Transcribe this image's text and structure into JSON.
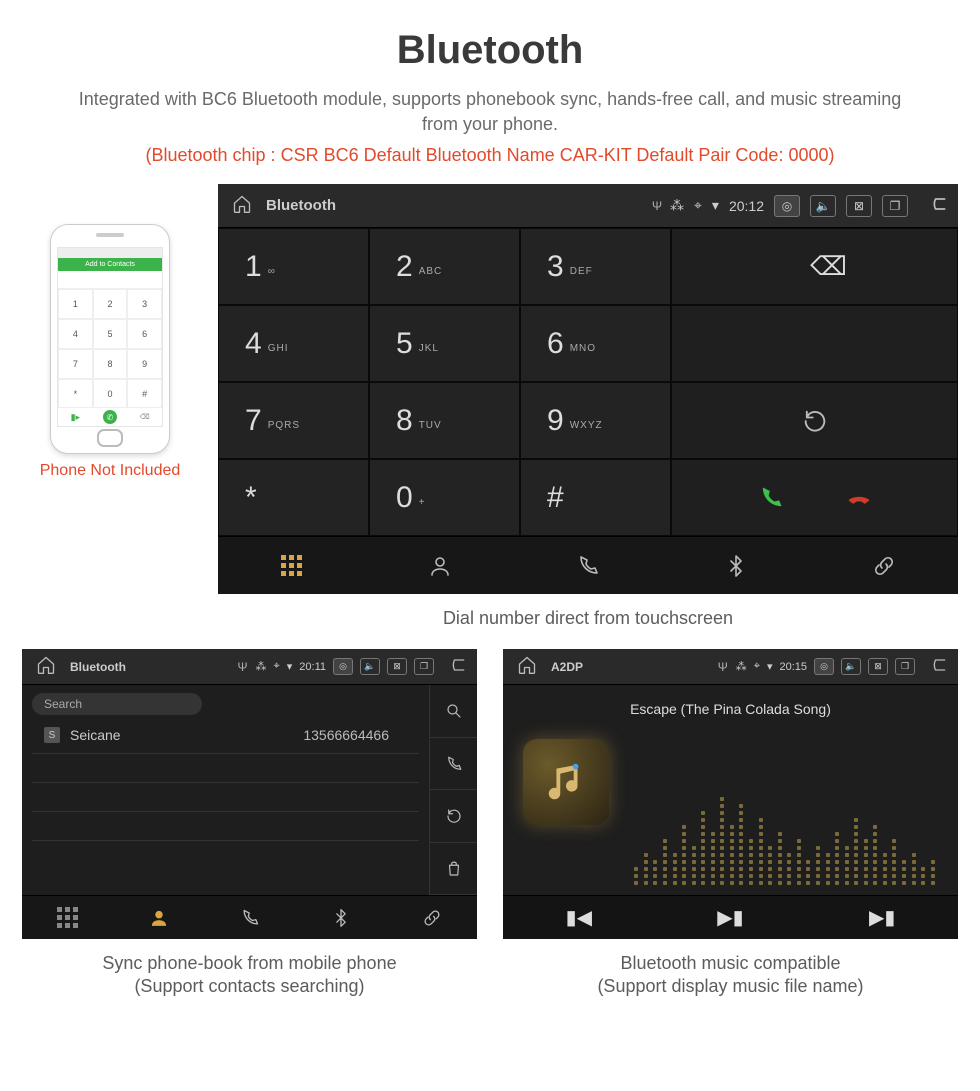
{
  "header": {
    "title": "Bluetooth",
    "subtitle": "Integrated with BC6 Bluetooth module, supports phonebook sync, hands-free call, and music streaming from your phone.",
    "spec": "(Bluetooth chip : CSR BC6     Default Bluetooth Name CAR-KIT     Default Pair Code: 0000)"
  },
  "phone": {
    "bar_label": "Add to Contacts",
    "caption": "Phone Not Included",
    "keys": [
      "1",
      "2",
      "3",
      "4",
      "5",
      "6",
      "7",
      "8",
      "9",
      "*",
      "0",
      "#"
    ]
  },
  "dialer": {
    "status": {
      "app": "Bluetooth",
      "time": "20:12"
    },
    "keys": [
      {
        "n": "1",
        "s": "∞"
      },
      {
        "n": "2",
        "s": "ABC"
      },
      {
        "n": "3",
        "s": "DEF"
      },
      {
        "n": "4",
        "s": "GHI"
      },
      {
        "n": "5",
        "s": "JKL"
      },
      {
        "n": "6",
        "s": "MNO"
      },
      {
        "n": "7",
        "s": "PQRS"
      },
      {
        "n": "8",
        "s": "TUV"
      },
      {
        "n": "9",
        "s": "WXYZ"
      },
      {
        "n": "*",
        "s": ""
      },
      {
        "n": "0",
        "s": "+"
      },
      {
        "n": "#",
        "s": ""
      }
    ],
    "caption": "Dial number direct from touchscreen"
  },
  "phonebook": {
    "status": {
      "app": "Bluetooth",
      "time": "20:11"
    },
    "search_placeholder": "Search",
    "contact": {
      "tag": "S",
      "name": "Seicane",
      "number": "13566664466"
    },
    "caption_l1": "Sync phone-book from mobile phone",
    "caption_l2": "(Support contacts searching)"
  },
  "music": {
    "status": {
      "app": "A2DP",
      "time": "20:15"
    },
    "track": "Escape (The Pina Colada Song)",
    "caption_l1": "Bluetooth music compatible",
    "caption_l2": "(Support display music file name)"
  },
  "eq_heights": [
    3,
    5,
    4,
    7,
    5,
    9,
    6,
    11,
    8,
    13,
    9,
    12,
    7,
    10,
    6,
    8,
    5,
    7,
    4,
    6,
    5,
    8,
    6,
    10,
    7,
    9,
    5,
    7,
    4,
    5,
    3,
    4
  ]
}
